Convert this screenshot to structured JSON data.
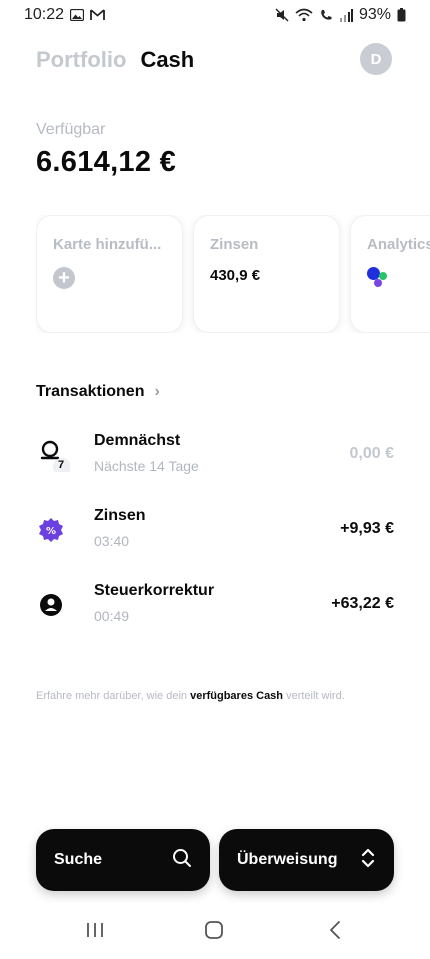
{
  "status_bar": {
    "time": "10:22",
    "battery": "93%",
    "icons": [
      "image-icon",
      "gmail-icon",
      "mute-icon",
      "wifi-icon",
      "wifi-call-icon",
      "signal-icon",
      "battery-icon"
    ]
  },
  "header": {
    "tabs": [
      {
        "label": "Portfolio",
        "active": false
      },
      {
        "label": "Cash",
        "active": true
      }
    ],
    "avatar_initial": "D"
  },
  "balance": {
    "label": "Verfügbar",
    "value": "6.614,12 €"
  },
  "cards": [
    {
      "title": "Karte hinzufü...",
      "icon": "plus-icon"
    },
    {
      "title": "Zinsen",
      "value": "430,9 €"
    },
    {
      "title": "Analytics",
      "icon": "dots-icon"
    }
  ],
  "transactions": {
    "title": "Transaktionen",
    "items": [
      {
        "name": "Demnächst",
        "sub": "Nächste 14 Tage",
        "amount": "0,00 €",
        "icon": "upcoming-icon",
        "badge": "7",
        "muted": true
      },
      {
        "name": "Zinsen",
        "sub": "03:40",
        "amount": "+9,93 €",
        "icon": "percent-badge-icon",
        "muted": false
      },
      {
        "name": "Steuerkorrektur",
        "sub": "00:49",
        "amount": "+63,22 €",
        "icon": "person-circle-icon",
        "muted": false
      }
    ]
  },
  "info": {
    "prefix": "Erfahre mehr darüber, wie dein ",
    "bold": "verfügbares Cash",
    "suffix": " verteilt wird."
  },
  "buttons": {
    "search": "Suche",
    "transfer": "Überweisung"
  },
  "colors": {
    "accent_purple": "#6b3fe0",
    "analytics_blue": "#1f2fdc",
    "analytics_green": "#27c46b",
    "analytics_violet": "#7a45e6",
    "muted_text": "#b6bac2"
  }
}
